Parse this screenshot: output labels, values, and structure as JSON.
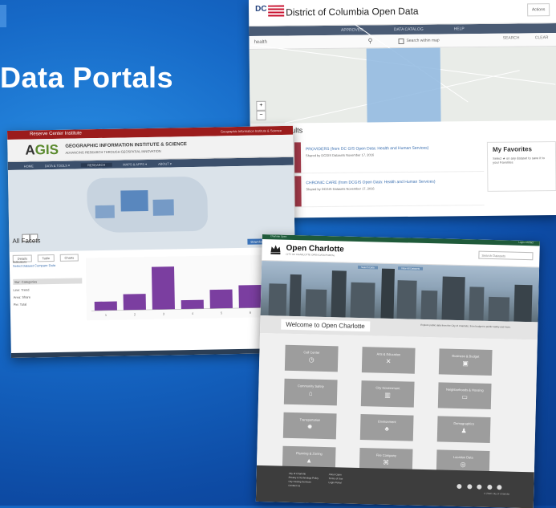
{
  "slide": {
    "title": "Data Portals"
  },
  "dc_portal": {
    "title": "District of Columbia Open Data",
    "logo_text": "DC",
    "menu_label": "Actions",
    "nav": [
      "APPROVED",
      "DATA CATALOG",
      "HELP"
    ],
    "search_placeholder": "health",
    "checkbox_label": "Search within map",
    "buttons": [
      "SEARCH",
      "CLEAR"
    ],
    "results_text": "1-8 of 8 results",
    "result_items": [
      {
        "title": "PROVIDERS  (from DC GIS Open Data: Health and Human Services)",
        "meta": "Shared by DCGIS Datasets  November 17, 2016"
      },
      {
        "title": "CHRONIC CARE  (from DCGIS Open Data: Health and Human Services)",
        "meta": "Shared by DCGIS Datasets  November 17, 2016"
      }
    ],
    "favorites_title": "My Favorites",
    "favorites_text": "Select ★ on any dataset to save it to your Favorites"
  },
  "agis_portal": {
    "top_title": "Reserve Center Institute",
    "top_right": "Geographic Information Institute & Science",
    "brand": "GIS",
    "brand_prefix": "A",
    "brand_line1": "GEOGRAPHIC INFORMATION INSTITUTE & SCIENCE",
    "brand_line2": "ADVANCING RESEARCH THROUGH GEOSPATIAL INNOVATION",
    "nav": [
      "HOME",
      "DATA & TOOLS ▾",
      "RESEARCH",
      "MAPS & APPS ▾",
      "ABOUT ▾"
    ],
    "heading": "All Facets",
    "tabs": [
      "Details",
      "Table",
      "Charts"
    ],
    "side_label": "Indicators",
    "side_links": "Select Dataset  Compare Data",
    "legend": [
      "Bar: Categories",
      "Line: Trend",
      "Area: Share",
      "Pie: Total"
    ],
    "buttons": [
      "Download",
      "Share"
    ],
    "chart_data": {
      "type": "bar",
      "categories": [
        "1",
        "2",
        "3",
        "4",
        "5",
        "6"
      ],
      "values": [
        18,
        32,
        86,
        18,
        38,
        46
      ],
      "ylim": [
        0,
        100
      ],
      "color": "#7b3ea0"
    }
  },
  "charlotte_portal": {
    "top_left": "Charlotte Open",
    "top_right": "Login  Contact",
    "title": "Open Charlotte",
    "subtitle": "CITY OF CHARLOTTE OPEN DATA PORTAL",
    "search_placeholder": "Search Datasets",
    "banner_tabs": [
      "Search Data",
      "View All Datasets"
    ],
    "welcome": "Welcome to Open Charlotte",
    "welcome_text": "Explore public data from the City of Charlotte, from budget to public safety and more.",
    "tiles": [
      {
        "label": "Call Center",
        "icon": "◷"
      },
      {
        "label": "Arts & Education",
        "icon": "✕"
      },
      {
        "label": "Business & Budget",
        "icon": "▣"
      },
      {
        "label": "Community Safety",
        "icon": "⌂"
      },
      {
        "label": "City Government",
        "icon": "▥"
      },
      {
        "label": "Neighborhoods & Housing",
        "icon": "▭"
      },
      {
        "label": "Transportation",
        "icon": "✹"
      },
      {
        "label": "Environment",
        "icon": "♣"
      },
      {
        "label": "Demographics",
        "icon": "♟"
      },
      {
        "label": "Planning & Zoning",
        "icon": "▲"
      },
      {
        "label": "Fire Company",
        "icon": "⌘"
      },
      {
        "label": "Location Data",
        "icon": "◎"
      }
    ],
    "footer_col1": [
      "City of Charlotte",
      "Privacy & Technology Policy",
      "City Closing Services",
      "Contact Us"
    ],
    "footer_col2": [
      "About Open",
      "Terms of Use",
      "Login Portal"
    ],
    "copyright": "© 2016 City of Charlotte"
  }
}
